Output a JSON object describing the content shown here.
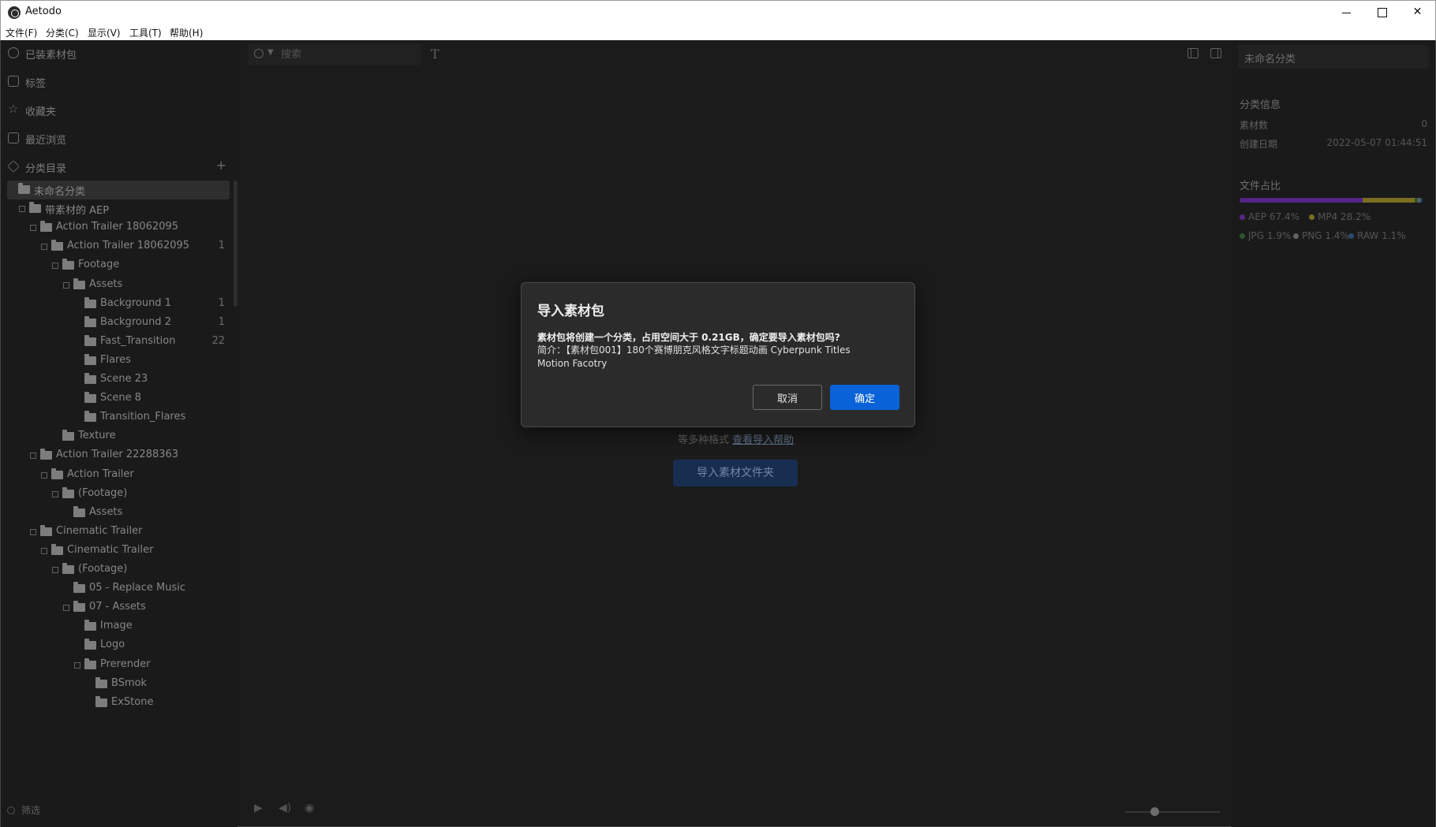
{
  "window": {
    "title": "Aetodo"
  },
  "menu": [
    "文件(F)",
    "分类(C)",
    "显示(V)",
    "工具(T)",
    "帮助(H)"
  ],
  "sidebar": {
    "nav": [
      {
        "label": "已装素材包",
        "icon": "package-icon"
      },
      {
        "label": "标签",
        "icon": "tag-icon"
      },
      {
        "label": "收藏夹",
        "icon": "star-icon"
      },
      {
        "label": "最近浏览",
        "icon": "history-icon"
      },
      {
        "label": "分类目录",
        "icon": "layers-icon"
      }
    ],
    "add_label": "+",
    "tree": [
      {
        "label": "未命名分类",
        "count": ""
      },
      {
        "label": "带素材的 AEP",
        "count": ""
      },
      {
        "label": "Action Trailer 18062095",
        "count": ""
      },
      {
        "label": "Action Trailer 18062095",
        "count": "1"
      },
      {
        "label": "Footage",
        "count": ""
      },
      {
        "label": "Assets",
        "count": ""
      },
      {
        "label": "Background 1",
        "count": "1"
      },
      {
        "label": "Background 2",
        "count": "1"
      },
      {
        "label": "Fast_Transition",
        "count": "22"
      },
      {
        "label": "Flares",
        "count": ""
      },
      {
        "label": "Scene 23",
        "count": ""
      },
      {
        "label": "Scene 8",
        "count": ""
      },
      {
        "label": "Transition_Flares",
        "count": ""
      },
      {
        "label": "Texture",
        "count": ""
      },
      {
        "label": "Action Trailer 22288363",
        "count": ""
      },
      {
        "label": "Action Trailer",
        "count": ""
      },
      {
        "label": "(Footage)",
        "count": ""
      },
      {
        "label": "Assets",
        "count": ""
      },
      {
        "label": "Cinematic Trailer",
        "count": ""
      },
      {
        "label": "Cinematic Trailer",
        "count": ""
      },
      {
        "label": "(Footage)",
        "count": ""
      },
      {
        "label": "05 - Replace Music",
        "count": ""
      },
      {
        "label": "07 - Assets",
        "count": ""
      },
      {
        "label": "Image",
        "count": ""
      },
      {
        "label": "Logo",
        "count": ""
      },
      {
        "label": "Prerender",
        "count": ""
      },
      {
        "label": "BSmok",
        "count": ""
      },
      {
        "label": "ExStone",
        "count": ""
      }
    ],
    "bottom_label": "筛选"
  },
  "toolbar": {
    "search_placeholder": "搜索",
    "text_tool": "T"
  },
  "content": {
    "hint_text": "等多种格式",
    "hint_link": "查看导入帮助",
    "import_button": "导入素材文件夹"
  },
  "right_panel": {
    "title": "未命名分类",
    "info_heading": "分类信息",
    "count_label": "素材数",
    "count_value": "0",
    "date_label": "创建日期",
    "date_value": "2022-05-07 01:44:51",
    "ratio_heading": "文件占比",
    "ratio": [
      {
        "name": "AEP 67.4%",
        "fraction": 0.674,
        "color": "#6a2fa8"
      },
      {
        "name": "MP4 28.2%",
        "fraction": 0.282,
        "color": "#9a8a2a"
      },
      {
        "name": "JPG 1.9%",
        "fraction": 0.019,
        "color": "#3a6a3a"
      },
      {
        "name": "PNG 1.4%",
        "fraction": 0.014,
        "color": "#7a7a7a"
      },
      {
        "name": "RAW 1.1%",
        "fraction": 0.011,
        "color": "#3a5a8a"
      }
    ]
  },
  "dialog": {
    "title": "导入素材包",
    "message": "素材包将创建一个分类，占用空间大于 0.21GB，确定要导入素材包吗?",
    "description": "简介：【素材包001】180个赛博朋克风格文字标题动画 Cyberpunk Titles Motion Facotry",
    "cancel_label": "取消",
    "ok_label": "确定"
  },
  "colors": {
    "accent": "#0a62d8",
    "dialog_bg": "#2b2b2b",
    "app_bg": "#222222"
  }
}
